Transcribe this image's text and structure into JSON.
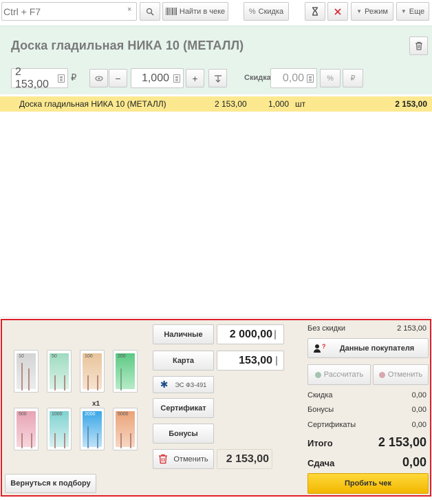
{
  "toolbar": {
    "search_placeholder": "Ctrl + F7",
    "clear_glyph": "×",
    "find_in_receipt": "Найти в чеке",
    "discount": "Скидка",
    "mode": "Режим",
    "more": "Еще"
  },
  "product": {
    "title": "Доска гладильная  НИКА 10 (МЕТАЛЛ)",
    "price": "2 153,00",
    "currency": "₽",
    "quantity": "1,000",
    "discount_label": "Скидка",
    "discount_value": "0,00",
    "percent": "%",
    "ruble": "₽"
  },
  "receipt_row": {
    "name": "Доска гладильная  НИКА 10 (МЕТАЛЛ)",
    "price": "2 153,00",
    "quantity": "1,000",
    "unit": "шт",
    "total": "2 153,00"
  },
  "banknotes": [
    {
      "label": "10"
    },
    {
      "label": "50"
    },
    {
      "label": "100"
    },
    {
      "label": "200"
    },
    {
      "label": "500"
    },
    {
      "label": "1000"
    },
    {
      "label": "2000"
    },
    {
      "label": "5000"
    }
  ],
  "banknote_multiplier": "x1",
  "payment": {
    "cash_label": "Наличные",
    "cash_value": "2 000,00",
    "card_label": "Карта",
    "card_value": "153,00",
    "es_label": "ЭС ФЗ-491",
    "certificate_label": "Сертификат",
    "bonuses_label": "Бонусы",
    "cancel_label": "Отменить",
    "cancel_value": "2 153,00",
    "back_label": "Вернуться к подбору"
  },
  "summary": {
    "no_discount_label": "Без скидки",
    "no_discount_value": "2 153,00",
    "customer_button": "Данные покупателя",
    "calculate_button": "Рассчитать",
    "cancel_button": "Отменить",
    "discount_label": "Скидка",
    "discount_value": "0,00",
    "bonuses_label": "Бонусы",
    "bonuses_value": "0,00",
    "certificates_label": "Сертификаты",
    "certificates_value": "0,00",
    "total_label": "Итого",
    "total_value": "2 153,00",
    "change_label": "Сдача",
    "change_value": "0,00",
    "pay_button": "Пробить чек"
  },
  "colors": {
    "accent_yellow": "#f2b800",
    "highlight_row": "#fce98f",
    "panel_border": "#e0202a",
    "product_bg": "#e6f4ec"
  }
}
